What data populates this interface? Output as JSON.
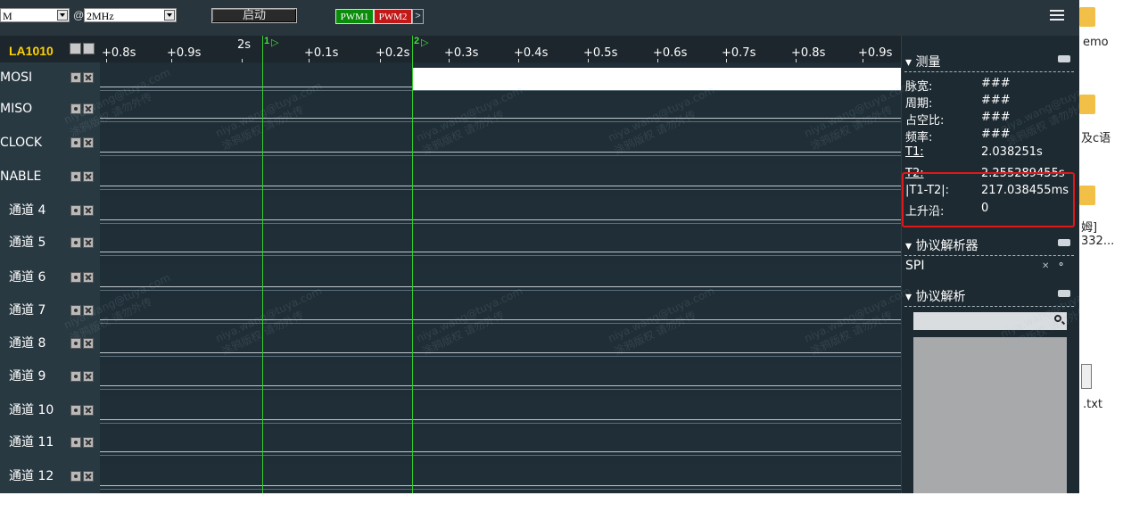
{
  "toolbar": {
    "mode_value": "M",
    "sample_rate_value": "2MHz",
    "start_label": "启动",
    "pwm1_label": "PWM1",
    "pwm2_label": "PWM2",
    "pwm_more_label": ">"
  },
  "channels": {
    "device_name": "LA1010",
    "items": [
      "MOSI",
      "MISO",
      "CLOCK",
      "NABLE",
      "通道 4",
      "通道 5",
      "通道 6",
      "通道 7",
      "通道 8",
      "通道 9",
      "通道 10",
      "通道 11",
      "通道 12"
    ]
  },
  "time_ruler": {
    "labels": [
      "+0.8s",
      "+0.9s",
      "2s",
      "+0.1s",
      "+0.2s",
      "+0.3s",
      "+0.4s",
      "+0.5s",
      "+0.6s",
      "+0.7s",
      "+0.8s",
      "+0.9s"
    ]
  },
  "cursors": {
    "c1_label": "1",
    "c2_label": "2"
  },
  "measure": {
    "title": "测量",
    "rows": [
      {
        "label": "脉宽:",
        "value": "###"
      },
      {
        "label": "周期:",
        "value": "###"
      },
      {
        "label": "占空比:",
        "value": "###"
      },
      {
        "label": "频率:",
        "value": "###"
      },
      {
        "label": "T1:",
        "value": "2.038251s"
      },
      {
        "label": "T2:",
        "value": "2.255289455s"
      },
      {
        "label": "|T1-T2|:",
        "value": "217.038455ms"
      },
      {
        "label": "上升沿:",
        "value": "0"
      }
    ]
  },
  "analyzer": {
    "title": "协议解析器",
    "protocol": "SPI"
  },
  "decode": {
    "title": "协议解析"
  },
  "desktop": {
    "text1": "emo",
    "text2": "及c语",
    "text3": "姆]",
    "text4": "332...",
    "text5": ".txt"
  },
  "watermark": {
    "line1": "niya.wang@tuya.com",
    "line2": "涂鸦版权 请勿外传"
  }
}
